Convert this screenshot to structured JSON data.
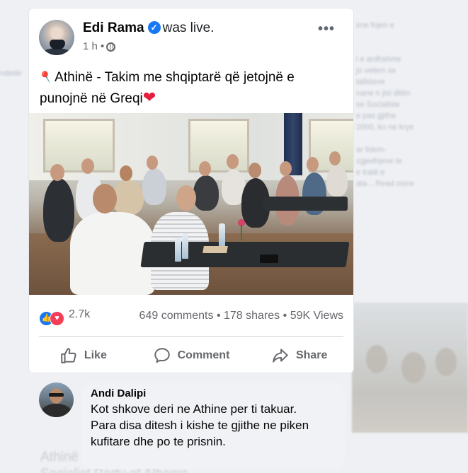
{
  "post": {
    "author": "Edi Rama",
    "status": "was live.",
    "time": "1 h",
    "separator": "•",
    "more": "•••",
    "text": "Athinë - Takim me shqiptarë që jetojnë e punojnë në Greqi",
    "pin_icon": "round-pushpin-icon",
    "heart_icon": "red-heart-icon"
  },
  "stats": {
    "reactions": "2.7k",
    "comments": "649 comments",
    "shares": "178 shares",
    "views": "59K Views",
    "dot": "•"
  },
  "actions": [
    {
      "label": "Like",
      "icon": "thumbs-up-icon"
    },
    {
      "label": "Comment",
      "icon": "speech-bubble-icon"
    },
    {
      "label": "Share",
      "icon": "share-arrow-icon"
    }
  ],
  "comment": {
    "author": "Andi Dalipi",
    "text": "Kot shkove deri ne Athine per ti takuar.\nPara disa ditesh i kishe te gjithe ne piken kufitare dhe po te prisnin."
  },
  "colors": {
    "facebook_blue": "#1877f2",
    "love_red": "#f33e58",
    "muted_text": "#65676b",
    "comment_bubble": "#f0f2f5"
  }
}
